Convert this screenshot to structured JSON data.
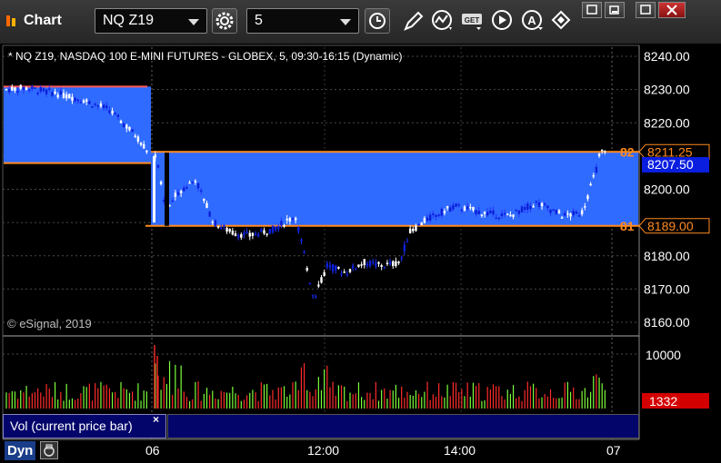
{
  "window": {
    "title": "Chart",
    "symbol_value": "NQ Z19",
    "interval_value": "5"
  },
  "toolbar": {
    "icons": [
      "settings-gear-icon",
      "clock-icon",
      "pencil-draw-icon",
      "study-wave-icon",
      "get-data-icon",
      "play-icon",
      "alert-a-icon",
      "link-diamond-icon"
    ],
    "window_buttons": [
      "restore-icon",
      "minimize-icon",
      "maximize-icon",
      "close-icon"
    ]
  },
  "chart": {
    "header": "* NQ Z19, NASDAQ 100 E-MINI FUTURES - GLOBEX, 5, 09:30-16:15 (Dynamic)",
    "copyright": "© eSignal, 2019",
    "price_axis": {
      "ticks": [
        "8240.00",
        "8230.00",
        "8220.00",
        "8210.00",
        "8200.00",
        "8190.00",
        "8180.00",
        "8170.00",
        "8160.00"
      ],
      "tick_values": [
        8240,
        8230,
        8220,
        8210,
        8200,
        8190,
        8180,
        8170,
        8160
      ],
      "min": 8156,
      "max": 8242
    },
    "price_labels": {
      "upper_level": "8211.25",
      "upper_level_left": "82",
      "current": "8207.50",
      "lower_level": "8189.00",
      "lower_level_left": "81"
    },
    "levels": {
      "upper": 8211.25,
      "lower": 8189.0,
      "prev_upper": 8230.9,
      "prev_lower": 8207.9
    },
    "volume_axis": {
      "ticks": [
        "10000"
      ],
      "value_label": "1332"
    },
    "time_axis": [
      "06",
      "12:00",
      "14:00",
      "07"
    ],
    "colors": {
      "zone_fill": "#2f6bff",
      "level_line": "#ff8a1e",
      "prev_line": "#ff5a5a",
      "up_candle": "#ffffff",
      "down_candle": "#0b1fd8",
      "volume_up": "#7cff3a",
      "volume_down": "#ff2b2b",
      "price_current_bg": "#0a1ee0",
      "volume_label_bg": "#d40000"
    }
  },
  "volume_pane": {
    "study_label": "Vol (current price bar)",
    "close_glyph": "×"
  },
  "footer": {
    "mode": "Dyn"
  }
}
